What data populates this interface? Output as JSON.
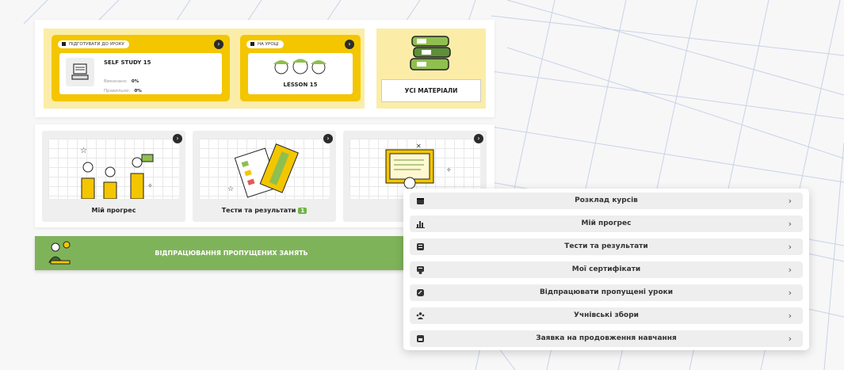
{
  "colors": {
    "accent_yellow": "#f3c600",
    "pale_yellow": "#fbeda8",
    "green": "#7fb35a",
    "badge_green": "#6fb548"
  },
  "homework": {
    "prepare_flag": "ПІДГОТУВАТИ ДО УРОКУ",
    "prepare_title": "SELF STUDY 15",
    "done_label": "Виконано:",
    "done_value": "0%",
    "correct_label": "Правильно:",
    "correct_value": "0%",
    "lesson_flag": "НА УРОЦІ",
    "lesson_title": "LESSON 15",
    "materials_button": "УСІ МАТЕРІАЛИ"
  },
  "tiles": [
    {
      "label": "Мій прогрес"
    },
    {
      "label": "Тести та результати",
      "badge": "1"
    },
    {
      "label": "Мої с"
    }
  ],
  "green_bar": {
    "label": "ВІДПРАЦЮВАННЯ ПРОПУЩЕНИХ ЗАНЯТЬ"
  },
  "menu": {
    "items": [
      {
        "label": "Розклад курсів",
        "icon": "calendar-icon"
      },
      {
        "label": "Мій прогрес",
        "icon": "bar-chart-icon"
      },
      {
        "label": "Тести та результати",
        "icon": "checklist-icon"
      },
      {
        "label": "Мої сертифікати",
        "icon": "certificate-icon"
      },
      {
        "label": "Відпрацювати пропущені уроки",
        "icon": "refresh-icon"
      },
      {
        "label": "Учнівські збори",
        "icon": "group-icon"
      },
      {
        "label": "Заявка на продовження навчання",
        "icon": "application-icon"
      }
    ],
    "chevron": "›"
  }
}
